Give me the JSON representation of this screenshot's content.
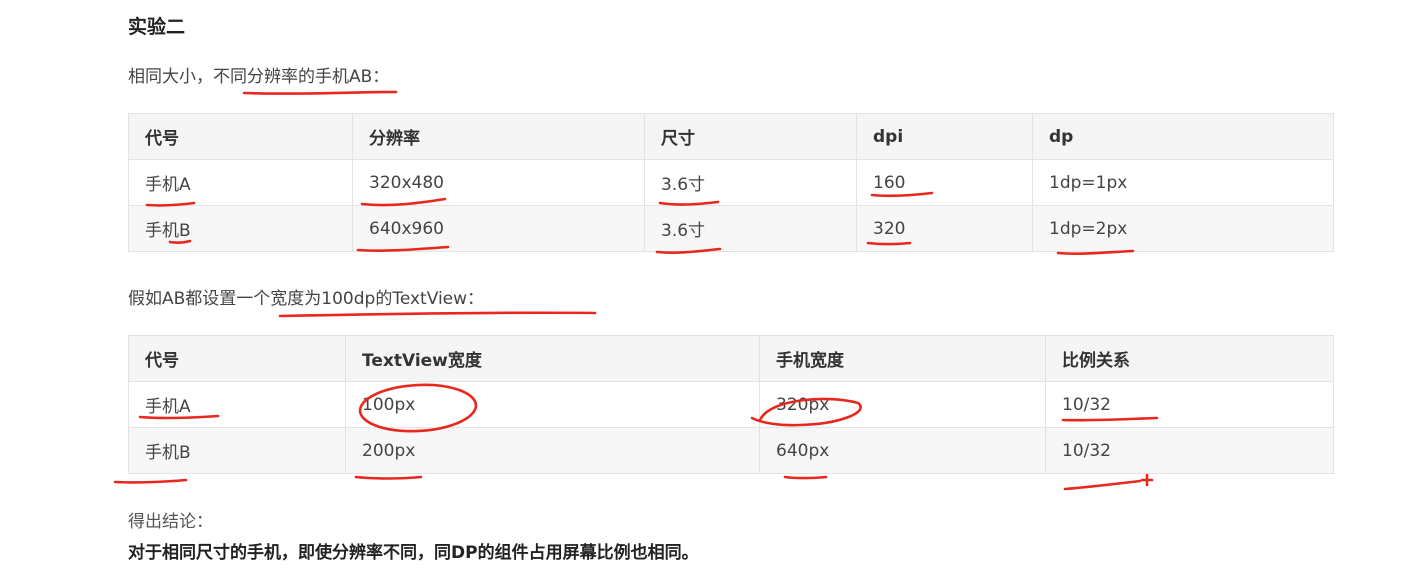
{
  "section_title": "实验二",
  "intro_text": "相同大小，不同分辨率的手机AB：",
  "table1": {
    "headers": [
      "代号",
      "分辨率",
      "尺寸",
      "dpi",
      "dp"
    ],
    "rows": [
      [
        "手机A",
        "320x480",
        "3.6寸",
        "160",
        "1dp=1px"
      ],
      [
        "手机B",
        "640x960",
        "3.6寸",
        "320",
        "1dp=2px"
      ]
    ]
  },
  "assumption_text": "假如AB都设置一个宽度为100dp的TextView：",
  "table2": {
    "headers": [
      "代号",
      "TextView宽度",
      "手机宽度",
      "比例关系"
    ],
    "rows": [
      [
        "手机A",
        "100px",
        "320px",
        "10/32"
      ],
      [
        "手机B",
        "200px",
        "640px",
        "10/32"
      ]
    ]
  },
  "conclusion_label": "得出结论：",
  "conclusion_text": "对于相同尺寸的手机，即使分辨率不同，同DP的组件占用屏幕比例也相同。",
  "colors": {
    "annotation": "#e8281e",
    "header_bg": "#f5f5f5",
    "border": "#e3e3e3"
  }
}
